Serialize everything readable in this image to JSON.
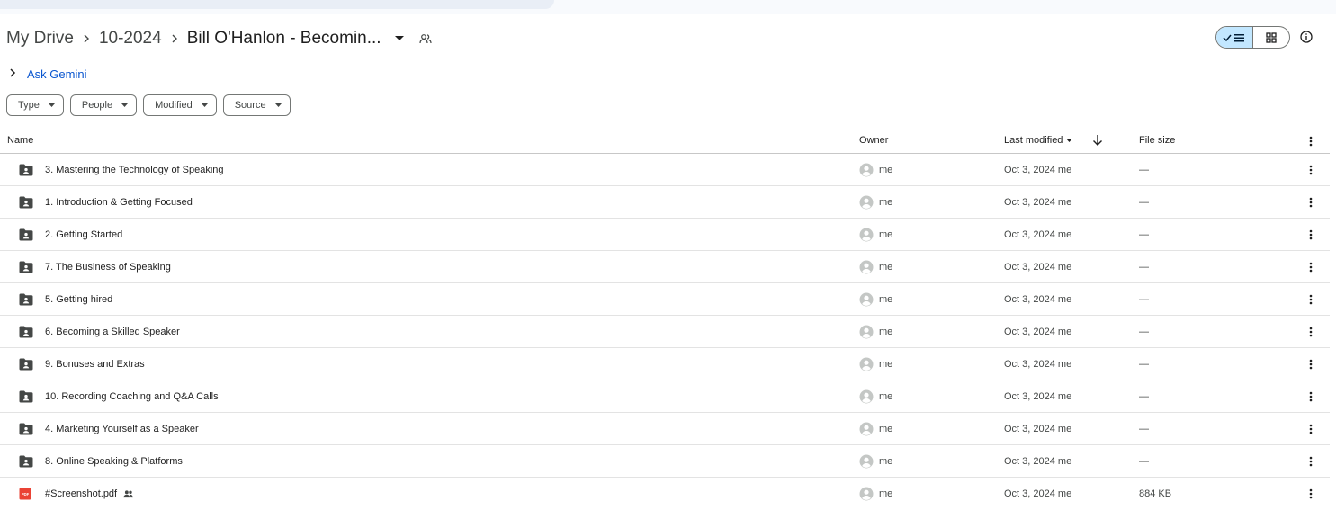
{
  "breadcrumb": {
    "items": [
      "My Drive",
      "10-2024"
    ],
    "current": "Bill O'Hanlon - Becomin..."
  },
  "gemini": {
    "label": "Ask Gemini"
  },
  "filters": [
    "Type",
    "People",
    "Modified",
    "Source"
  ],
  "columns": {
    "name": "Name",
    "owner": "Owner",
    "modified": "Last modified",
    "size": "File size"
  },
  "rows": [
    {
      "type": "folder",
      "name": "3. Mastering the Technology of Speaking",
      "owner": "me",
      "modified": "Oct 3, 2024 me",
      "size": "—"
    },
    {
      "type": "folder",
      "name": "1. Introduction & Getting Focused",
      "owner": "me",
      "modified": "Oct 3, 2024 me",
      "size": "—"
    },
    {
      "type": "folder",
      "name": "2. Getting Started",
      "owner": "me",
      "modified": "Oct 3, 2024 me",
      "size": "—"
    },
    {
      "type": "folder",
      "name": "7. The Business of Speaking",
      "owner": "me",
      "modified": "Oct 3, 2024 me",
      "size": "—"
    },
    {
      "type": "folder",
      "name": "5. Getting hired",
      "owner": "me",
      "modified": "Oct 3, 2024 me",
      "size": "—"
    },
    {
      "type": "folder",
      "name": "6. Becoming a Skilled Speaker",
      "owner": "me",
      "modified": "Oct 3, 2024 me",
      "size": "—"
    },
    {
      "type": "folder",
      "name": "9. Bonuses and Extras",
      "owner": "me",
      "modified": "Oct 3, 2024 me",
      "size": "—"
    },
    {
      "type": "folder",
      "name": "10. Recording Coaching and Q&A Calls",
      "owner": "me",
      "modified": "Oct 3, 2024 me",
      "size": "—"
    },
    {
      "type": "folder",
      "name": "4. Marketing Yourself as a Speaker",
      "owner": "me",
      "modified": "Oct 3, 2024 me",
      "size": "—"
    },
    {
      "type": "folder",
      "name": "8. Online Speaking & Platforms",
      "owner": "me",
      "modified": "Oct 3, 2024 me",
      "size": "—"
    },
    {
      "type": "pdf",
      "name": "#Screenshot.pdf",
      "shared": true,
      "owner": "me",
      "modified": "Oct 3, 2024 me",
      "size": "884 KB"
    }
  ],
  "icons": {
    "folder": "shared-folder-icon",
    "pdf": "pdf-icon",
    "owner_avatar": "default-avatar-icon"
  },
  "colors": {
    "accent": "#0b57d0",
    "toggle_active": "#c2e7ff",
    "pdf_red": "#ea4335",
    "folder_gray": "#444746"
  }
}
